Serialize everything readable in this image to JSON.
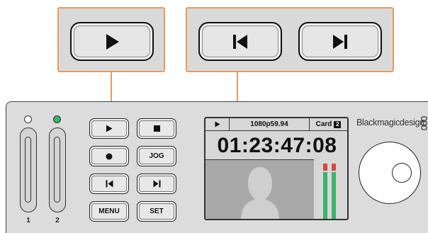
{
  "callouts": {
    "left": {
      "icons": [
        "play-icon"
      ]
    },
    "right": {
      "icons": [
        "skip-back-icon",
        "skip-forward-icon"
      ]
    },
    "leader_color": "#e89a5c"
  },
  "device": {
    "slots": [
      {
        "label": "1",
        "led_color": "#ffffff"
      },
      {
        "label": "2",
        "led_color": "#3bb36a"
      }
    ],
    "buttons": {
      "play_icon": "play-icon",
      "stop_icon": "stop-icon",
      "record_icon": "record-icon",
      "jog_label": "JOG",
      "skip_back_icon": "skip-back-icon",
      "skip_forward_icon": "skip-forward-icon",
      "menu_label": "MENU",
      "set_label": "SET"
    },
    "lcd": {
      "status_icon": "play-icon",
      "format": "1080p59.94",
      "card_label": "Card",
      "card_number": "2",
      "timecode": "01:23:47:08",
      "audio_meter_color": "#3bb36a",
      "audio_peak_color": "#d9463a"
    },
    "brand": "Blackmagicdesign"
  }
}
